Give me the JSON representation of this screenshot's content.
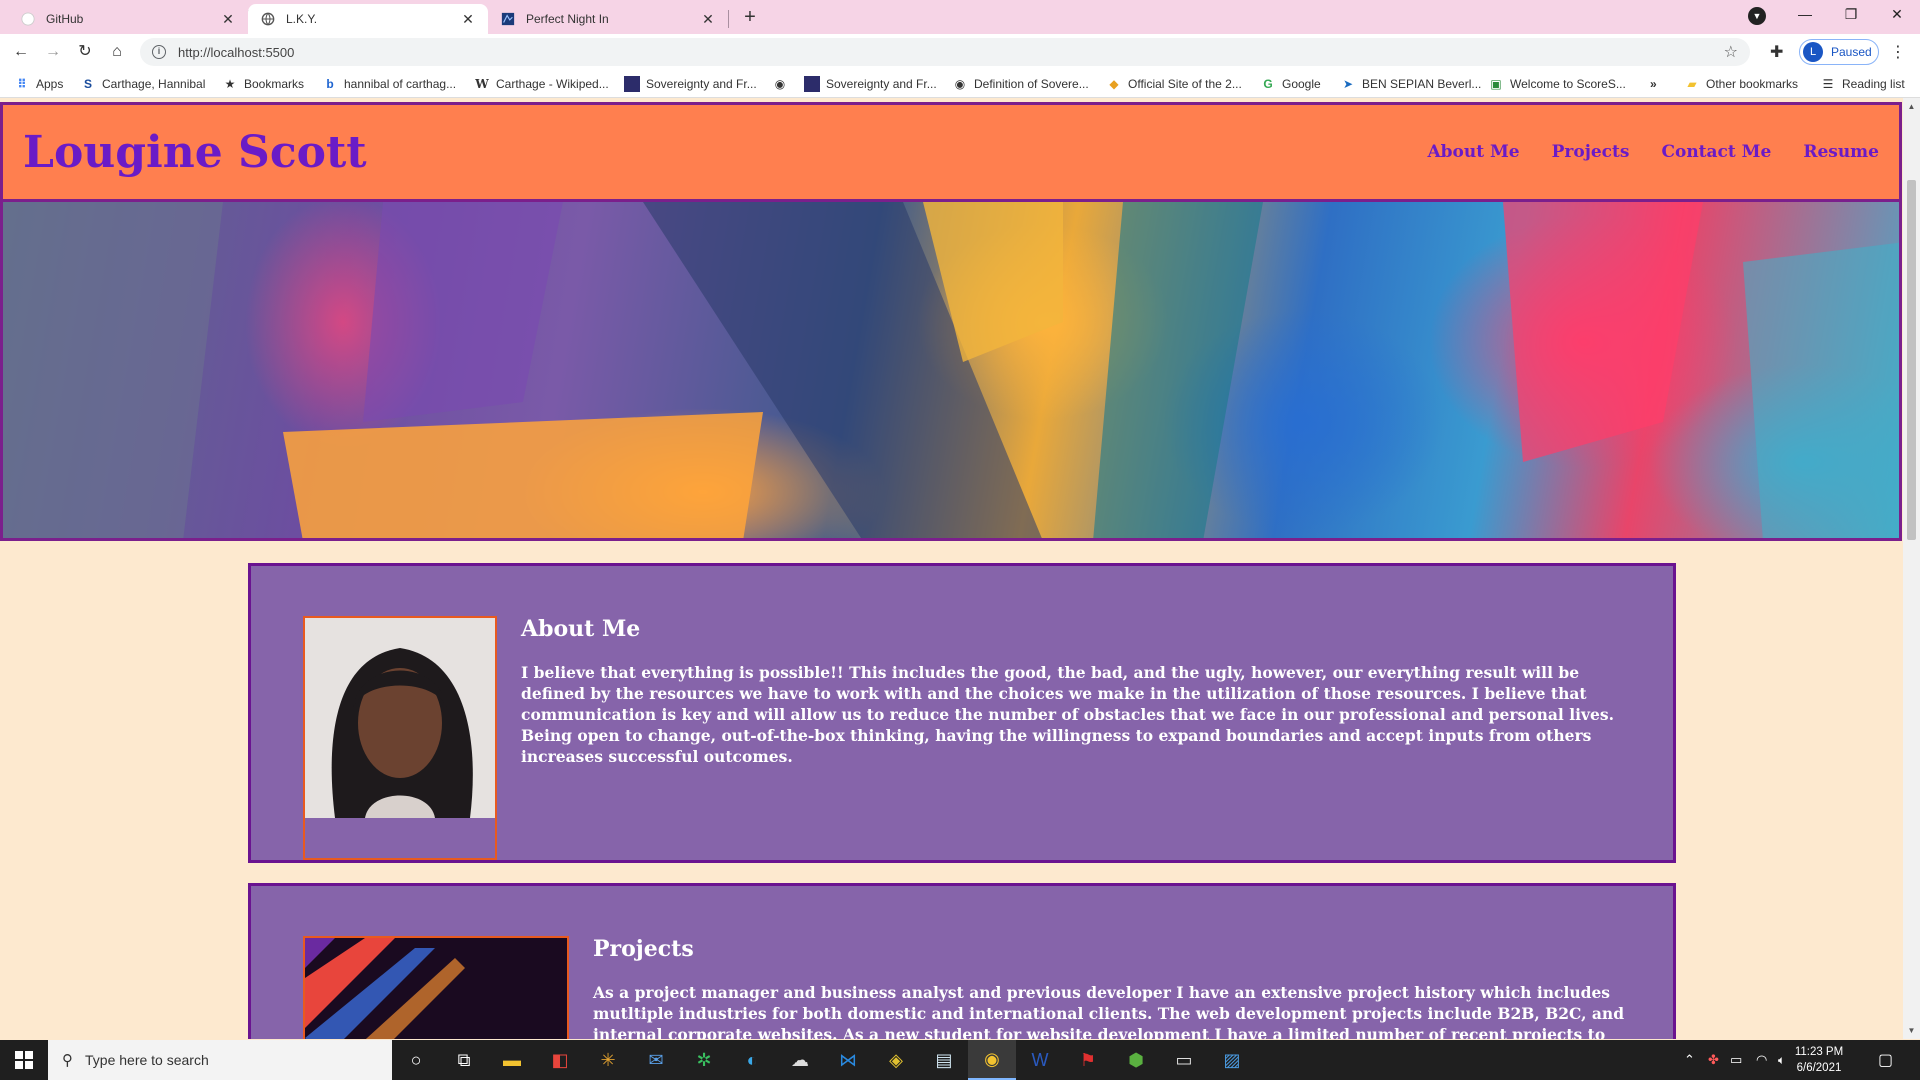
{
  "browser": {
    "tabs": [
      {
        "title": "GitHub",
        "icon": "github-icon"
      },
      {
        "title": "L.K.Y.",
        "icon": "globe-icon"
      },
      {
        "title": "Perfect Night In",
        "icon": "tab-site-icon"
      }
    ],
    "url": "http://localhost:5500",
    "profile_initial": "L",
    "profile_status": "Paused",
    "bookmarks": [
      "Apps",
      "Carthage, Hannibal",
      "Bookmarks",
      "hannibal of carthag...",
      "Carthage - Wikiped...",
      "Sovereignty and Fr...",
      "",
      "Sovereignty and Fr...",
      "Definition of Sovere...",
      "Official Site of the 2...",
      "Google",
      "BEN SEPIAN Beverl...",
      "Welcome to ScoreS...",
      "»",
      "Other bookmarks",
      "Reading list"
    ]
  },
  "site": {
    "title": "Lougine Scott",
    "nav": [
      "About Me",
      "Projects",
      "Contact Me",
      "Resume"
    ],
    "about": {
      "heading": "About Me",
      "text": "I believe that everything is possible!! This includes the good, the bad, and the ugly, however, our everything result will be defined by the resources we have to work with and the choices we make in the utilization of those resources. I believe that communication is key and will allow us to reduce the number of obstacles that we face in our professional and personal lives. Being open to change, out-of-the-box thinking, having the willingness to expand boundaries and accept inputs from others increases successful outcomes."
    },
    "projects": {
      "heading": "Projects",
      "text": "As a project manager and business analyst and previous developer I have an extensive project history which includes mutltiple industries for both domestic and international clients. The web development projects include B2B, B2C, and internal corporate websites. As a new student for website development I have a limited number of recent projects to display."
    }
  },
  "taskbar": {
    "search_placeholder": "Type here to search",
    "time": "11:23 PM",
    "date": "6/6/2021"
  },
  "colors": {
    "header_bg": "#ff7f4f",
    "accent_purple": "#6a1bc7",
    "card_bg": "#8664aa",
    "page_bg": "#fde9cf"
  }
}
